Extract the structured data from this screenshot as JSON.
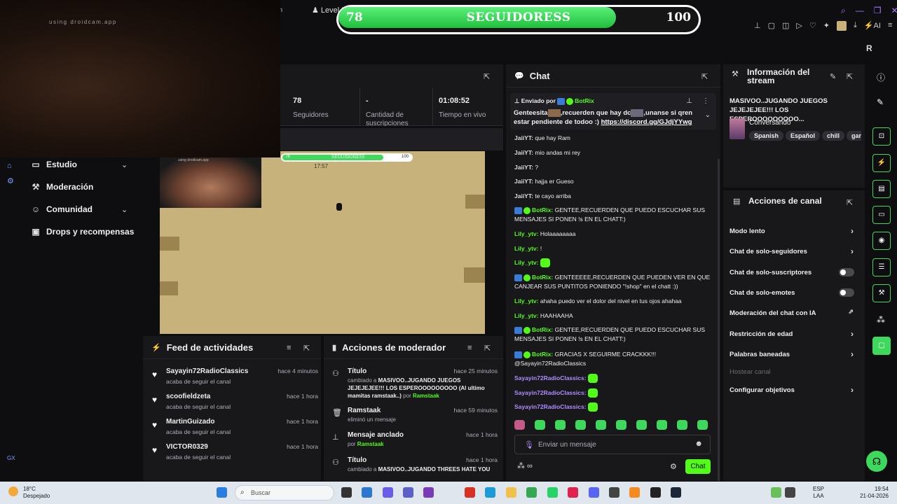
{
  "webcam_overlay": {
    "text": "using droidcam.app"
  },
  "browser": {
    "tab_partial": "n",
    "tab_label": "Level D",
    "ai_label": "AI",
    "r_label": "R"
  },
  "followers_bar": {
    "current": "78",
    "title": "SEGUIDORESS",
    "goal": "100",
    "progress": 0.78
  },
  "stats": [
    {
      "value": "78",
      "label": "Seguidores"
    },
    {
      "value": "-",
      "label": "Cantidad de suscripciones"
    },
    {
      "value": "01:08:52",
      "label": "Tiempo en vivo"
    }
  ],
  "video": {
    "face_caption": "using droidcam.app",
    "mini_bar": {
      "current": "78",
      "title": "SEGUIDORESS",
      "goal": "100"
    },
    "timer": "17:57"
  },
  "left_nav": [
    {
      "label": "Estudio"
    },
    {
      "label": "Moderación"
    },
    {
      "label": "Comunidad"
    },
    {
      "label": "Drops y recompensas"
    }
  ],
  "feed": {
    "title": "Feed de actividades",
    "items": [
      {
        "name": "Sayayin72RadioClassics",
        "sub": "acaba de seguir el canal",
        "time": "hace 4 minutos"
      },
      {
        "name": "scoofieldzeta",
        "sub": "acaba de seguir el canal",
        "time": "hace 1 hora"
      },
      {
        "name": "MartinGuizado",
        "sub": "acaba de seguir el canal",
        "time": "hace 1 hora"
      },
      {
        "name": "VICTOR0329",
        "sub": "acaba de seguir el canal",
        "time": "hace 1 hora"
      }
    ]
  },
  "mod_actions": {
    "title": "Acciones de moderador",
    "items": [
      {
        "name": "Título",
        "time": "hace 25 minutos",
        "prefix": "cambiado a",
        "detail": "MASIVOO..JUGANDO JUEGOS JEJEJEJEE!!! LOS ESPEROOOOOOOOO (Al ultimo mamitas ramstaak..)",
        "por": "por",
        "user": "Ramstaak"
      },
      {
        "name": "Ramstaak",
        "time": "hace 59 minutos",
        "detail": "eliminó un mensaje"
      },
      {
        "name": "Mensaje anclado",
        "time": "hace 1 hora",
        "por": "por",
        "user": "Ramstaak"
      },
      {
        "name": "Título",
        "time": "hace 1 hora",
        "prefix": "cambiado a",
        "detail": "MASIVOO..JUGANDO THREES HATE YOU"
      }
    ]
  },
  "chat": {
    "title": "Chat",
    "pinned": {
      "header_prefix": "Enviado por",
      "header_user": "BotRix",
      "body_1": "Genteesita",
      "body_2": ",recuerden que hay dc",
      "body_3": ",unanse si qren estar pendiente de todoo :)",
      "link": "https://discord.gg/GJdjYYwg"
    },
    "messages": [
      {
        "user": "JaiiYT",
        "text": "que hay Ram"
      },
      {
        "user": "JaiiYT",
        "text": "mio andas mi rey"
      },
      {
        "user": "JaiiYT",
        "text": "?"
      },
      {
        "user": "JaiiYT",
        "text": "hajja er Gueso"
      },
      {
        "user": "JaiiYT",
        "text": "te cayo arriba"
      },
      {
        "user": "BotRix",
        "text": "GENTEE,RECUERDEN QUE PUEDO ESCUCHAR SUS MENSAJES SI PONEN !s EN EL CHATT:)"
      },
      {
        "user": "Lily_ytv",
        "text": "Holaaaaaaaa"
      },
      {
        "user": "Lily_ytv",
        "text": "!"
      },
      {
        "user": "Lily_ytv",
        "text": ""
      },
      {
        "user": "BotRix",
        "text": "GENTEEEEE,RECUERDEN QUE PUEDEN VER EN QUE CANJEAR SUS PUNTITOS PONIENDO \"!shop\" en el chatt :))"
      },
      {
        "user": "Lily_ytv",
        "text": "ahaha puedo ver el dolor del nivel en tus ojos ahahaa"
      },
      {
        "user": "Lily_ytv",
        "text": "HAAHAAHA"
      },
      {
        "user": "BotRix",
        "text": "GENTEE,RECUERDEN QUE PUEDO ESCUCHAR SUS MENSAJES SI PONEN !s EN EL CHATT:)"
      },
      {
        "user": "BotRix",
        "text": "GRACIAS X SEGUIRME CRACKKK!!! @Sayayin72RadioClassics"
      },
      {
        "user": "Sayayin72RadioClassics",
        "text": ""
      },
      {
        "user": "Sayayin72RadioClassics",
        "text": ""
      },
      {
        "user": "Sayayin72RadioClassics",
        "text": ""
      }
    ],
    "input_placeholder": "Enviar un mensaje",
    "send_label": "Chat"
  },
  "stream_info": {
    "title": "Información del stream",
    "stream_title": "MASIVOO..JUGANDO JUEGOS JEJEJEJEE!!! LOS ESPEROOOOOOOOO...",
    "category": "Conversando",
    "tags": [
      "Spanish",
      "Español",
      "chill",
      "gar"
    ]
  },
  "channel_actions": {
    "title": "Acciones de canal",
    "items": [
      {
        "label": "Modo lento",
        "control": "chevron"
      },
      {
        "label": "Chat de solo-seguidores",
        "control": "chevron"
      },
      {
        "label": "Chat de solo-suscriptores",
        "control": "toggle"
      },
      {
        "label": "Chat de solo-emotes",
        "control": "toggle"
      },
      {
        "label": "Moderación del chat con IA",
        "control": "external"
      },
      {
        "label": "Restricción de edad",
        "control": "chevron"
      },
      {
        "label": "Palabras baneadas",
        "control": "chevron"
      },
      {
        "label": "Hostear canal",
        "control": "none"
      },
      {
        "label": "Configurar objetivos",
        "control": "chevron"
      }
    ]
  },
  "taskbar": {
    "temp": "18°C",
    "weather": "Despejado",
    "search": "Buscar",
    "lang_1": "ESP",
    "lang_2": "LAA",
    "time": "19:54",
    "date": "21-04-2026",
    "gx": "GX"
  },
  "colors": {
    "accent": "#53fc18",
    "bg": "#0e0e10",
    "panel": "#18181b"
  }
}
